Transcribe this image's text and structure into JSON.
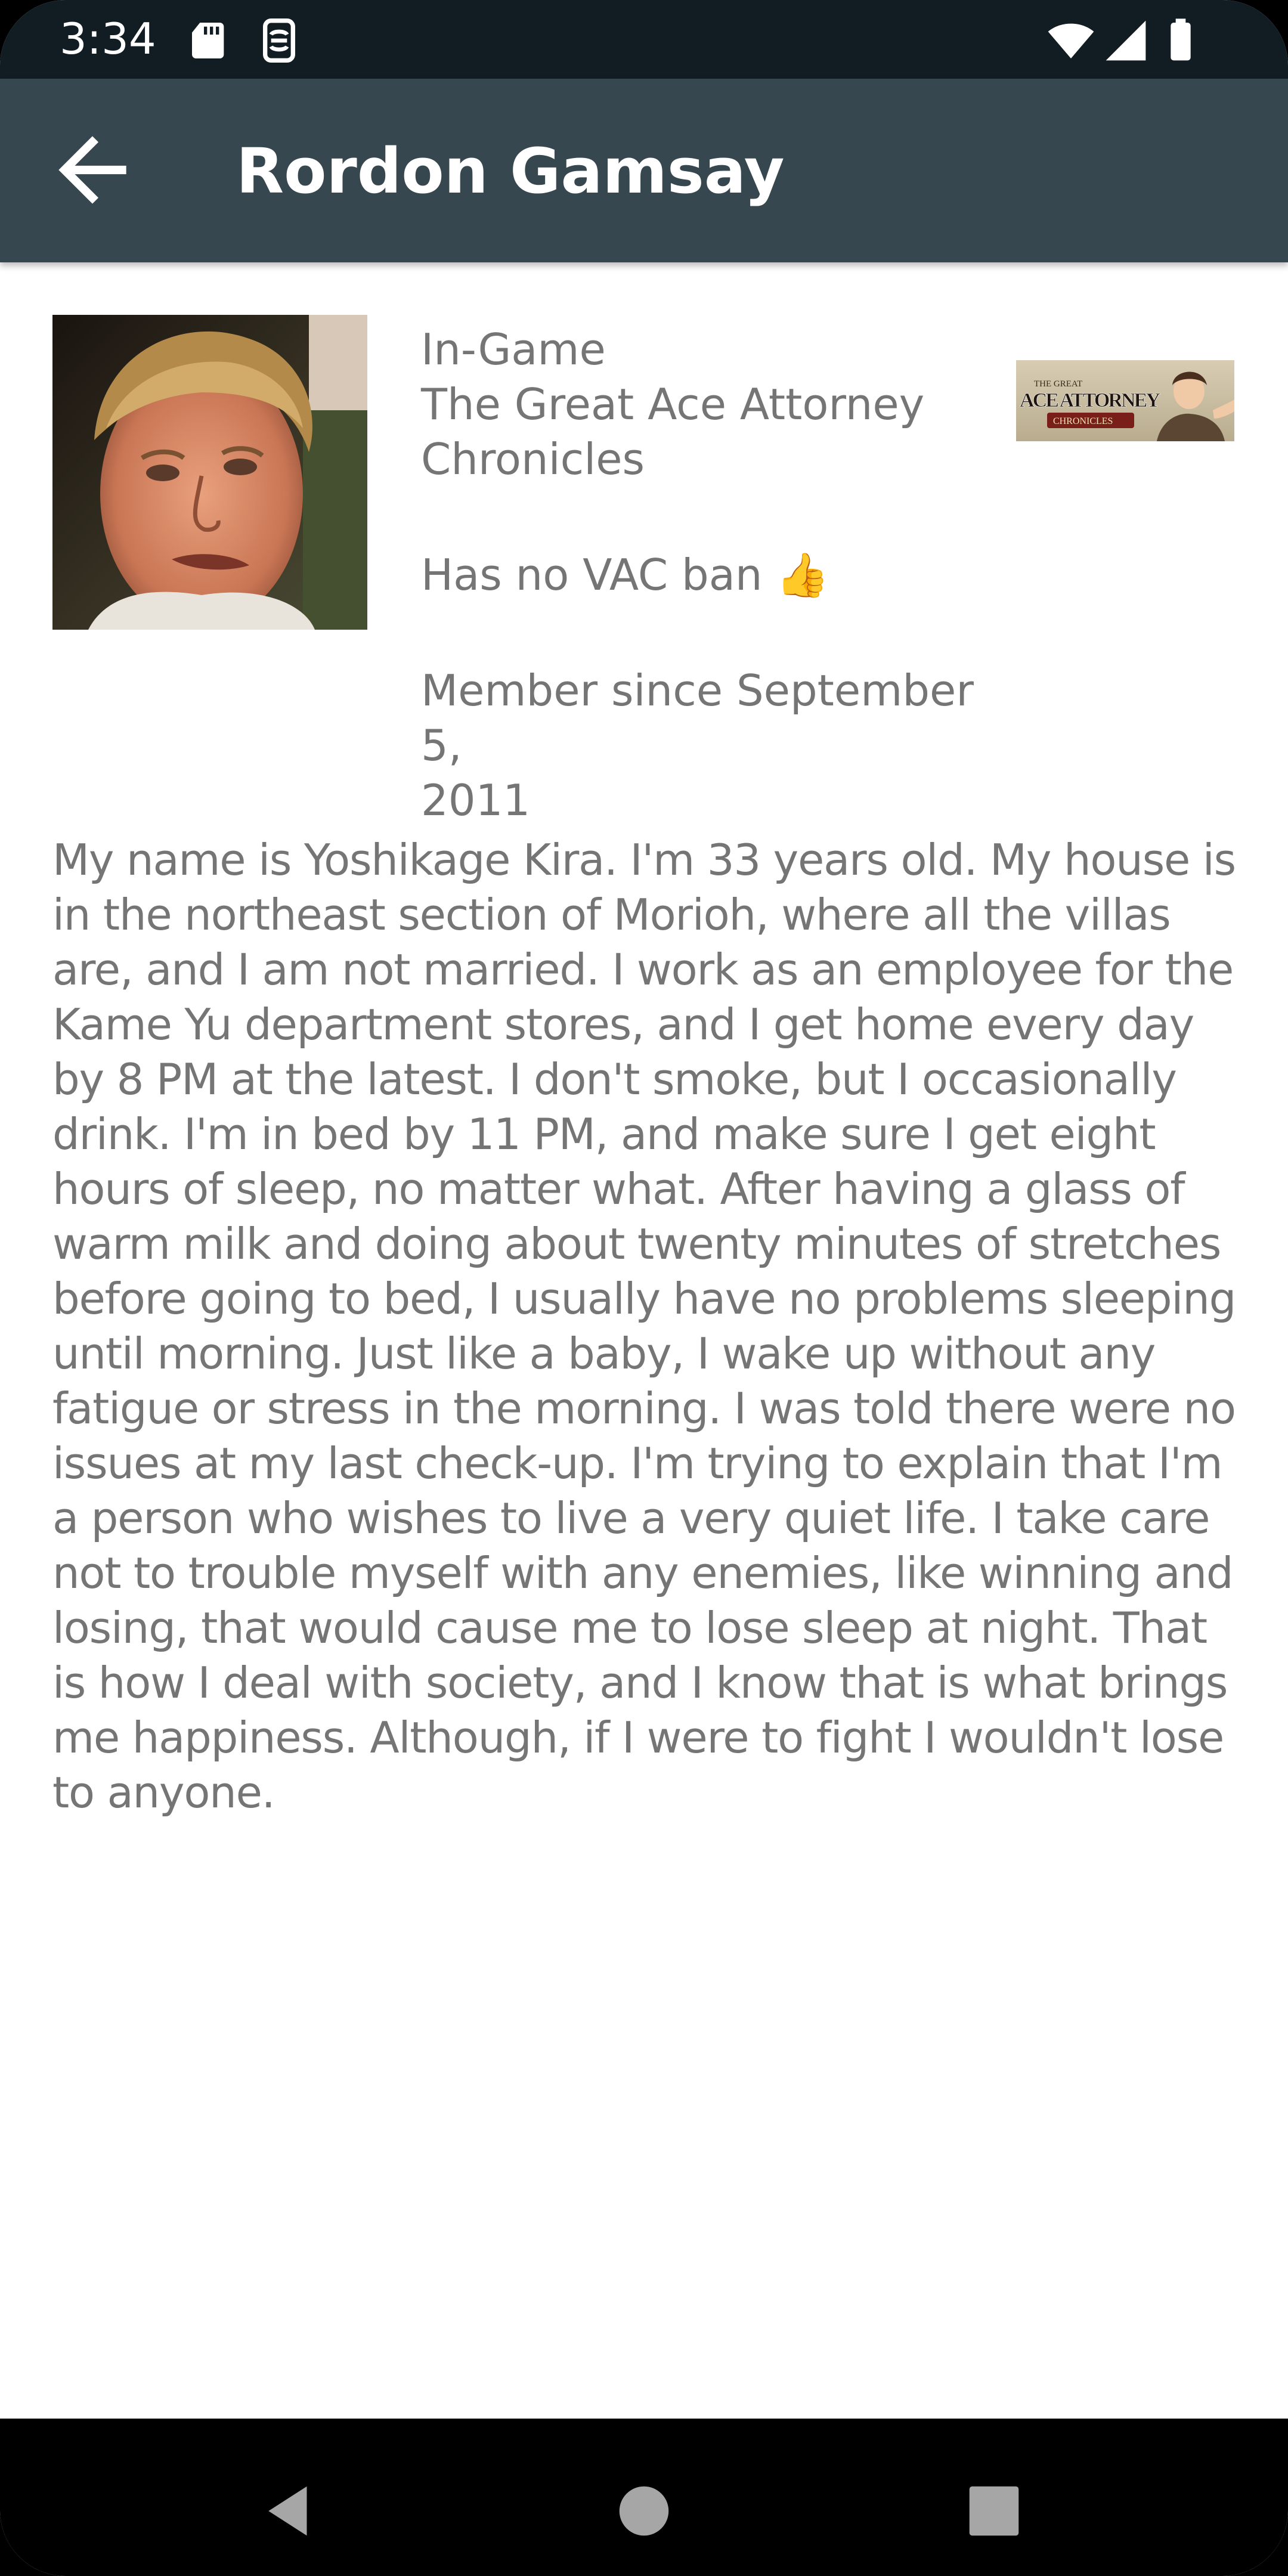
{
  "status_bar": {
    "time": "3:34",
    "icons_left": [
      "sd-card-icon",
      "screenshot-icon"
    ],
    "icons_right": [
      "wifi-icon",
      "signal-icon",
      "battery-icon"
    ]
  },
  "app_bar": {
    "title": "Rordon Gamsay",
    "back_icon": "arrow-back-icon"
  },
  "profile": {
    "status": "In-Game",
    "game_line1": "The Great Ace Attorney",
    "game_line2": "Chronicles",
    "vac_text": "Has no VAC ban",
    "vac_emoji": "👍",
    "member_line1": "Member since September 5,",
    "member_line2": "2011",
    "game_banner_text": {
      "top": "THE GREAT",
      "main": "ACE ATTORNEY",
      "bottom": "CHRONICLES"
    },
    "summary": "My name is Yoshikage Kira. I'm 33 years old. My house is in the northeast section of Morioh, where all the villas are, and I am not married. I work as an employee for the Kame Yu department stores, and I get home every day by 8 PM at the latest. I don't smoke, but I occasionally drink. I'm in bed by 11 PM, and make sure I get eight hours of sleep, no matter what. After having a glass of warm milk and doing about twenty minutes of stretches before going to bed, I usually have no problems sleeping until morning. Just like a baby, I wake up without any fatigue or stress in the morning. I was told there were no issues at my last check-up. I'm trying to explain that I'm a person who wishes to live a very quiet life. I take care not to trouble myself with any enemies, like winning and losing, that would cause me to lose sleep at night. That is how I deal with society, and I know that is what brings me happiness. Although, if I were to fight I wouldn't lose to anyone."
  },
  "nav_bar": {
    "buttons": [
      "back-triangle-icon",
      "home-circle-icon",
      "recents-square-icon"
    ]
  },
  "colors": {
    "status_bar": "#111d23",
    "app_bar": "#37474f",
    "text_secondary": "#757575",
    "background": "#ffffff"
  }
}
